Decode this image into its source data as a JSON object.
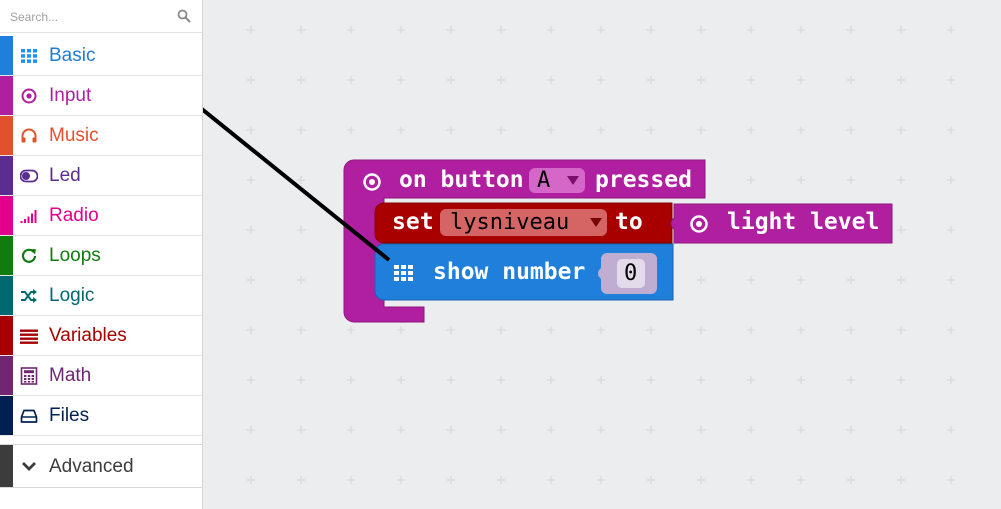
{
  "search": {
    "placeholder": "Search..."
  },
  "categories": [
    {
      "label": "Basic",
      "color": "#1e90ff",
      "bar": "#1f7fdb",
      "icon": "grid-icon"
    },
    {
      "label": "Input",
      "color": "#b01fa0",
      "bar": "#b01fa0",
      "icon": "target-icon"
    },
    {
      "label": "Music",
      "color": "#e2502c",
      "bar": "#e2502c",
      "icon": "headphones-icon"
    },
    {
      "label": "Led",
      "color": "#5c2d91",
      "bar": "#5c2d91",
      "icon": "toggle-icon"
    },
    {
      "label": "Radio",
      "color": "#e3008c",
      "bar": "#e3008c",
      "icon": "signal-icon"
    },
    {
      "label": "Loops",
      "color": "#107c10",
      "bar": "#107c10",
      "icon": "refresh-icon"
    },
    {
      "label": "Logic",
      "color": "#006970",
      "bar": "#006970",
      "icon": "shuffle-icon"
    },
    {
      "label": "Variables",
      "color": "#a80000",
      "bar": "#a80000",
      "icon": "list-icon"
    },
    {
      "label": "Math",
      "color": "#712672",
      "bar": "#712672",
      "icon": "calculator-icon"
    },
    {
      "label": "Files",
      "color": "#002050",
      "bar": "#002050",
      "icon": "drive-icon"
    }
  ],
  "advanced": {
    "label": "Advanced",
    "icon": "chevron-down-icon"
  },
  "blocks": {
    "event": {
      "prefix": "on button",
      "button": "A",
      "suffix": "pressed",
      "color": "#b01fa0"
    },
    "set": {
      "keyword": "set",
      "variable": "lysniveau",
      "to": "to",
      "color": "#a80000"
    },
    "light": {
      "label": "light level",
      "color": "#b01fa0"
    },
    "show": {
      "label": "show number",
      "value": "0",
      "color": "#1f7fdb"
    }
  }
}
